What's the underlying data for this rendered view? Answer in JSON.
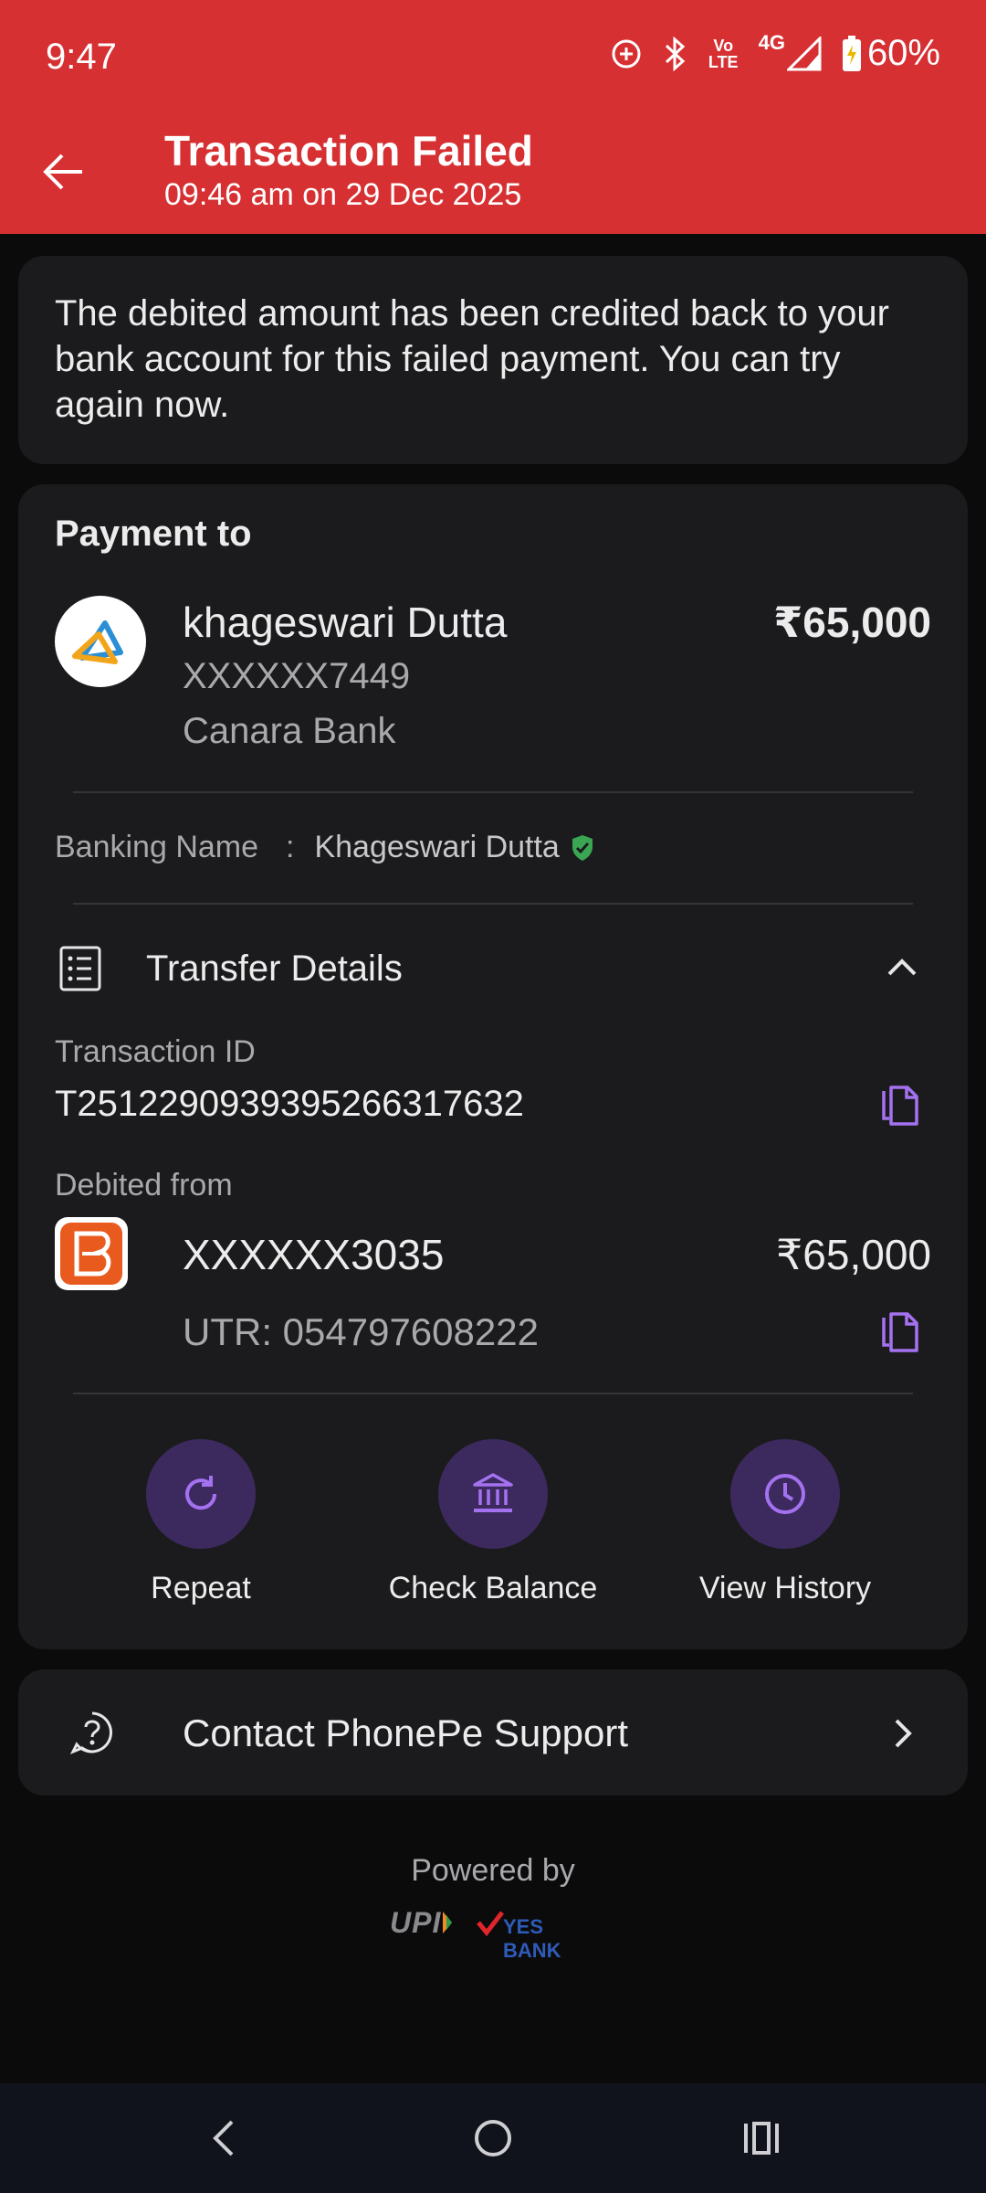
{
  "status_bar": {
    "time": "9:47",
    "network_top": "Vo",
    "network_bottom": "LTE",
    "network_type": "4G",
    "battery": "60%"
  },
  "header": {
    "title": "Transaction Failed",
    "subtitle": "09:46 am on 29 Dec 2025",
    "bg_color": "#d63033"
  },
  "notice": {
    "text": "The debited amount has been credited back to your bank account for this failed payment. You can try again now."
  },
  "payment": {
    "section_title": "Payment to",
    "payee_name": "khageswari Dutta",
    "amount": "₹65,000",
    "account": "XXXXXX7449",
    "bank": "Canara Bank",
    "banking_name_label": "Banking Name",
    "banking_name_sep": ":",
    "banking_name_value": "Khageswari Dutta"
  },
  "transfer": {
    "title": "Transfer Details",
    "txn_label": "Transaction ID",
    "txn_id": "T2512290939395266317632",
    "debited_label": "Debited from",
    "debit_account": "XXXXXX3035",
    "debit_amount": "₹65,000",
    "utr": "UTR: 054797608222"
  },
  "actions": [
    {
      "label": "Repeat",
      "icon": "repeat-icon"
    },
    {
      "label": "Check Balance",
      "icon": "bank-icon"
    },
    {
      "label": "View History",
      "icon": "clock-icon"
    }
  ],
  "support": {
    "label": "Contact PhonePe Support"
  },
  "footer": {
    "powered_by": "Powered by",
    "upi_text": "UPI",
    "yes_bank_text": "YES BANK"
  },
  "colors": {
    "accent": "#a472f0",
    "action_bg": "#3c2a5e",
    "verified": "#3aa653"
  }
}
